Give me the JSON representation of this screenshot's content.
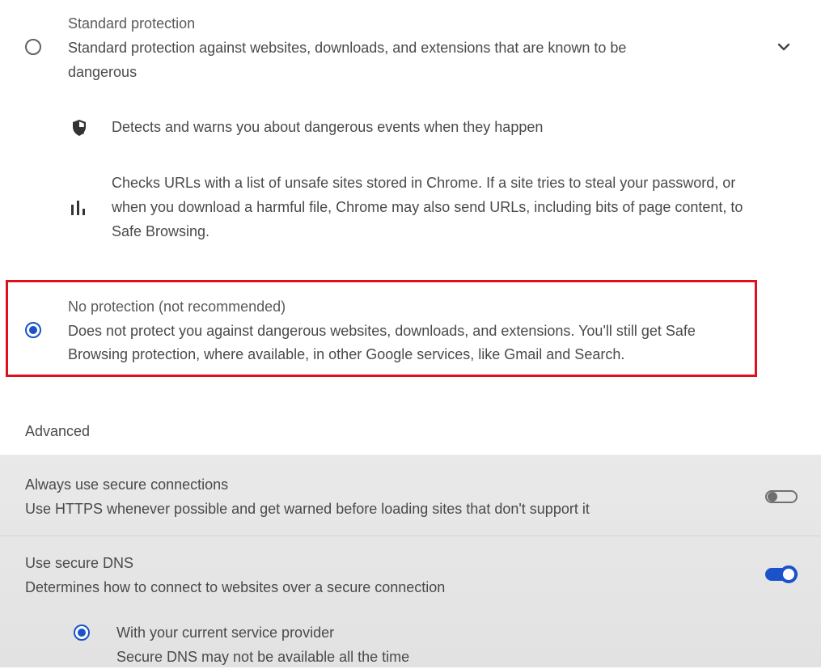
{
  "standard": {
    "title": "Standard protection",
    "desc_line1": "Standard protection against websites, downloads, and extensions that are known to be",
    "desc_line2": "dangerous",
    "feature1": "Detects and warns you about dangerous events when they happen",
    "feature2_line1": "Checks URLs with a list of unsafe sites stored in Chrome. If a site tries to steal your password, or",
    "feature2_line2": "when you download a harmful file, Chrome may also send URLs, including bits of page content, to",
    "feature2_line3": "Safe Browsing."
  },
  "no_protection": {
    "title": "No protection (not recommended)",
    "desc_line1": "Does not protect you against dangerous websites, downloads, and extensions. You'll still get Safe",
    "desc_line2": "Browsing protection, where available, in other Google services, like Gmail and Search."
  },
  "advanced": {
    "heading": "Advanced",
    "https": {
      "title": "Always use secure connections",
      "desc": "Use HTTPS whenever possible and get warned before loading sites that don't support it",
      "enabled": false
    },
    "dns": {
      "title": "Use secure DNS",
      "desc": "Determines how to connect to websites over a secure connection",
      "enabled": true,
      "option_title": "With your current service provider",
      "option_desc": "Secure DNS may not be available all the time"
    }
  },
  "colors": {
    "accent": "#1a53c9",
    "highlight": "#e0101a"
  },
  "icons": [
    "radio-unselected",
    "chevron-down-icon",
    "shield-icon",
    "bar-chart-icon",
    "radio-selected"
  ]
}
